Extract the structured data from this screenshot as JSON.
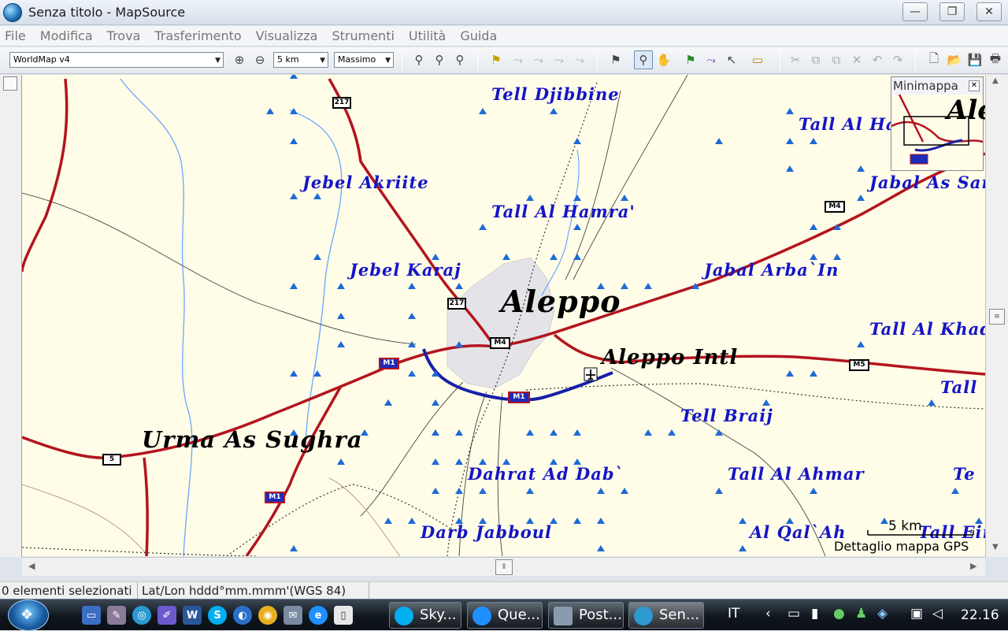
{
  "window": {
    "title": "Senza titolo - MapSource",
    "minimize_glyph": "—",
    "maximize_glyph": "❐",
    "close_glyph": "✕"
  },
  "menu": [
    "File",
    "Modifica",
    "Trova",
    "Trasferimento",
    "Visualizza",
    "Strumenti",
    "Utilità",
    "Guida"
  ],
  "toolbar": {
    "map_product": "WorldMap v4",
    "zoom_scale": "5 km",
    "detail_level": "Massimo",
    "zoom_in_glyph": "⊕",
    "zoom_out_glyph": "⊖",
    "find_glyph": "⚲",
    "flag_glyph": "⚑",
    "hand_glyph": "✋",
    "pointer_glyph": "↖",
    "route_glyph": "⤳",
    "ruler_glyph": "▭",
    "cut_glyph": "✂",
    "copy_glyph": "⧉",
    "paste_glyph": "📋",
    "delete_glyph": "✕",
    "undo_glyph": "↶",
    "redo_glyph": "↷",
    "new_glyph": "🗋",
    "open_glyph": "📂",
    "save_glyph": "💾",
    "print_glyph": "🖶"
  },
  "map": {
    "labels": {
      "tell_djibbine": "Tell Djibbine",
      "tall_al_ha": "Tall Al Ha",
      "jebel_akriite": "Jebel Akriite",
      "jabal_as_sar": "Jabal As Sar",
      "tall_al_hamra": "Tall Al Hamra'",
      "jebel_karaj": "Jebel Karaj",
      "jabal_arba_in": "Jabal Arba`In",
      "aleppo": "Aleppo",
      "tall_al_khadi": "Tall Al Khadi",
      "aleppo_intl": "Aleppo Intl",
      "tall_right": "Tall",
      "tell_braij": "Tell Braij",
      "urma_as_sughra": "Urma As Sughra",
      "dahrat_ad_dab": "Dahrat Ad Dab`",
      "tall_al_ahmar": "Tall Al Ahmar",
      "te": "Te",
      "darb_jabboul": "Darb Jabboul",
      "al_qal_ah": "Al Qal`Ah",
      "tall_eir": "Tall Eir"
    },
    "shields": {
      "r217a": "217",
      "r217b": "217",
      "m4a": "M4",
      "m4b": "M4",
      "m1a": "M1",
      "m1b": "M1",
      "m1c": "M1",
      "m5": "M5",
      "r5": "5"
    },
    "scale_label": "5 km",
    "detail_caption": "Dettaglio mappa GPS",
    "colors": {
      "background": "#fffde8",
      "road": "#b3141e",
      "highway": "#1820a8",
      "water": "#6aa6ff",
      "urban": "#e4e4e8",
      "label": "#1414c8"
    }
  },
  "minimap": {
    "title": "Minimappa",
    "close_glyph": "✕",
    "partial_label": "Ale"
  },
  "status": {
    "selection": "0 elementi selezionati",
    "coord_format": "Lat/Lon hddd°mm.mmm'(WGS 84)"
  },
  "taskbar": {
    "tasks": [
      "Sky...",
      "Que...",
      "Post...",
      "Sen..."
    ],
    "language": "IT",
    "clock": "22.16"
  }
}
